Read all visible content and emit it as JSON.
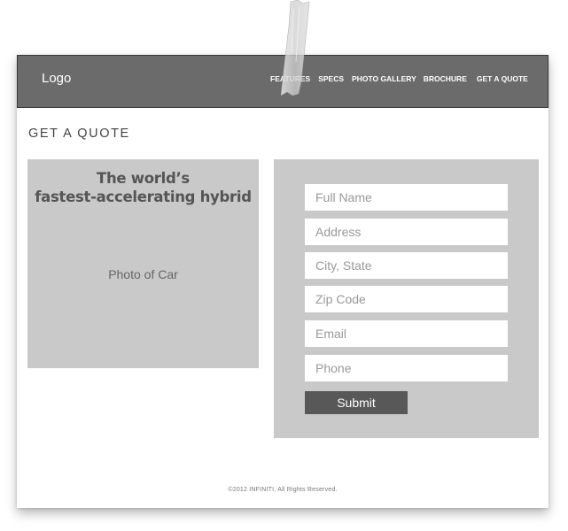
{
  "header": {
    "logo": "Logo",
    "nav": [
      {
        "label": "FEATURES"
      },
      {
        "label": "SPECS"
      },
      {
        "label": "PHOTO GALLERY"
      },
      {
        "label": "BROCHURE"
      },
      {
        "label": "GET A QUOTE"
      }
    ]
  },
  "main": {
    "page_title": "GET A QUOTE",
    "photo_panel": {
      "headline_line1": "The world’s",
      "headline_line2": "fastest-accelerating hybrid",
      "placeholder": "Photo of Car"
    },
    "form": {
      "fields": [
        {
          "placeholder": "Full Name"
        },
        {
          "placeholder": "Address"
        },
        {
          "placeholder": "City, State"
        },
        {
          "placeholder": "Zip Code"
        },
        {
          "placeholder": "Email"
        },
        {
          "placeholder": "Phone"
        }
      ],
      "submit_label": "Submit"
    }
  },
  "footer": {
    "copyright": "©2012 INFINITI, All Rights Reserved."
  },
  "colors": {
    "navbar": "#6b6b6b",
    "panel": "#c9c9c9",
    "button": "#585858"
  },
  "decorations": {
    "tape": "tape-strip"
  }
}
